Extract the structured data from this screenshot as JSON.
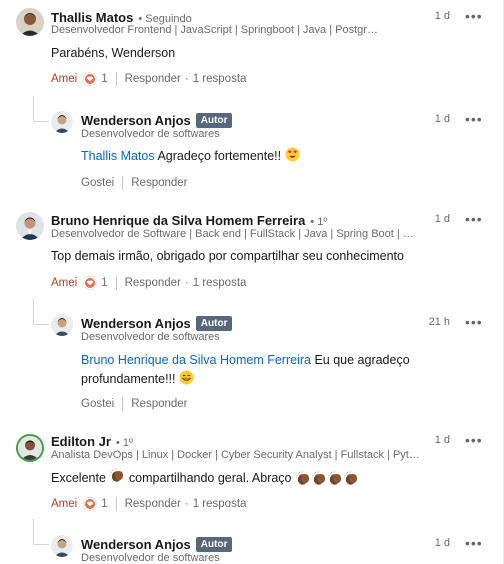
{
  "comments": [
    {
      "author": "Thallis Matos",
      "relation": "• Seguindo",
      "headline": "Desenvolvedor Frontend | JavaScript | Springboot | Java | PostgreSQL",
      "time": "1 d",
      "text": "Parabéns, Wenderson",
      "like_label": "Amei",
      "reaction_count": "1",
      "reply_label": "Responder",
      "replies_label": "1 resposta",
      "reply": {
        "author": "Wenderson Anjos",
        "badge": "Autor",
        "headline": "Desenvolvedor de softwares",
        "time": "1 d",
        "mention": "Thallis Matos",
        "text": "Agradeço fortemente!!",
        "like_label": "Gostei",
        "reply_label": "Responder"
      }
    },
    {
      "author": "Bruno Henrique da Silva Homem Ferreira",
      "relation": "• 1º",
      "headline": "Desenvolvedor de Software | Back end | FullStack | Java | Spring Boot | Postgr...",
      "time": "1 d",
      "text": "Top demais irmão, obrigado por compartilhar seu conhecimento",
      "like_label": "Amei",
      "reaction_count": "1",
      "reply_label": "Responder",
      "replies_label": "1 resposta",
      "reply": {
        "author": "Wenderson Anjos",
        "badge": "Autor",
        "headline": "Desenvolvedor de softwares",
        "time": "21 h",
        "mention": "Bruno Henrique da Silva Homem Ferreira",
        "text": "Eu que agradeço profundamente!!!",
        "like_label": "Gostei",
        "reply_label": "Responder"
      }
    },
    {
      "author": "Edilton Jr",
      "relation": "• 1º",
      "headline": "Analista DevOps | Linux | Docker | Cyber Security Analyst | Fullstack | Python |...",
      "time": "1 d",
      "text_before": "Excelente",
      "text_after": "compartilhando geral. Abraço",
      "like_label": "Amei",
      "reaction_count": "1",
      "reply_label": "Responder",
      "replies_label": "1 resposta",
      "reply": {
        "author": "Wenderson Anjos",
        "badge": "Autor",
        "headline": "Desenvolvedor de softwares",
        "time": "1 d"
      }
    }
  ],
  "more_label": "•••",
  "colors": {
    "link": "#0a66c2",
    "love": "#b24020",
    "badge": "#56687a"
  },
  "icons": [
    "heart-reaction-icon",
    "heart-eyes-emoji",
    "grin-emoji",
    "clap-emoji",
    "more-icon"
  ]
}
